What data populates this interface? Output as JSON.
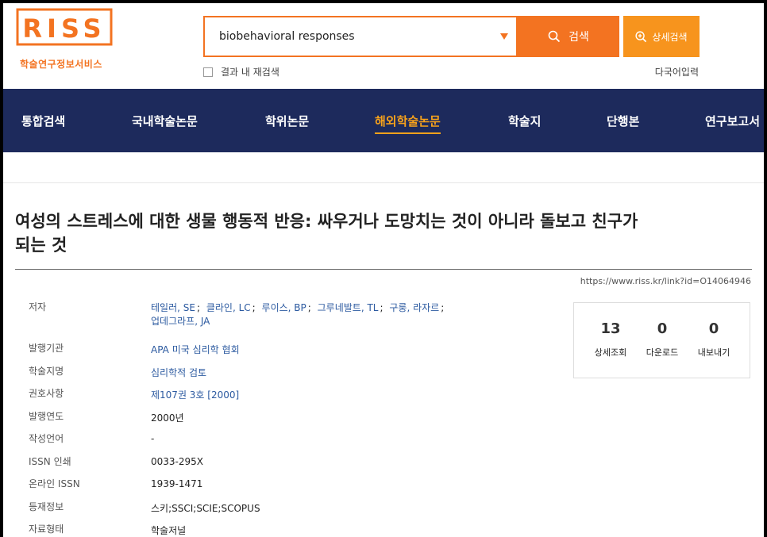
{
  "header": {
    "logo_text": "RISS",
    "logo_sub": "학술연구정보서비스",
    "search_value": "biobehavioral responses",
    "search_button": "검색",
    "detail_button": "상세검색",
    "research_in_results": "결과 내 재검색",
    "multi_lang_input": "다국어입력"
  },
  "nav": {
    "items": [
      {
        "label": "통합검색"
      },
      {
        "label": "국내학술논문"
      },
      {
        "label": "학위논문"
      },
      {
        "label": "해외학술논문"
      },
      {
        "label": "학술지"
      },
      {
        "label": "단행본"
      },
      {
        "label": "연구보고서"
      }
    ],
    "active": "해외학술논문"
  },
  "article": {
    "title_line1": "여성의 스트레스에 대한 생물 행동적 반응: 싸우거나 도망치는 것이 아니라 돌보고 친구가",
    "title_line2": "되는 것",
    "link_url": "https://www.riss.kr/link?id=O14064946",
    "authors_label": "저자",
    "authors": [
      "테일러, SE",
      "클라인, LC",
      "루이스, BP",
      "그루네발트, TL",
      "구룽, 라자르",
      "업데그라프, JA"
    ],
    "fields": [
      {
        "label": "발행기관",
        "value": "APA 미국 심리학 협회",
        "link": true
      },
      {
        "label": "학술지명",
        "value": "심리학적 검토",
        "link": true
      },
      {
        "label": "권호사항",
        "value": "제107권 3호 [2000]",
        "link": true
      },
      {
        "label": "발행연도",
        "value": "2000년",
        "link": false
      },
      {
        "label": "작성언어",
        "value": "-",
        "link": false
      },
      {
        "label": "ISSN 인쇄",
        "value": "0033-295X",
        "link": false
      },
      {
        "label": "온라인 ISSN",
        "value": "1939-1471",
        "link": false
      },
      {
        "label": "등재정보",
        "value": "스키;SSCI;SCIE;SCOPUS",
        "link": false
      },
      {
        "label": "자료형태",
        "value": "학술저널",
        "link": false
      }
    ]
  },
  "stats": {
    "views": {
      "num": "13",
      "label": "상세조회"
    },
    "downloads": {
      "num": "0",
      "label": "다운로드"
    },
    "exports": {
      "num": "0",
      "label": "내보내기"
    }
  },
  "colors": {
    "brand_orange": "#f37321",
    "nav_bg": "#1d2a5c",
    "nav_active": "#f7a21b",
    "link_blue": "#2c5aa0"
  }
}
